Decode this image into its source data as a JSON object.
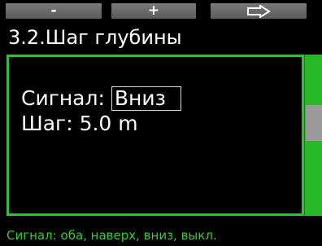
{
  "softkeys": {
    "minus_label": "-",
    "plus_label": "+",
    "next_icon": "arrow-right-outline-icon"
  },
  "title": "3.2.Шаг глубины",
  "settings": {
    "signal_label": "Сигнал:",
    "signal_value": "Вниз",
    "step_label": "Шаг:",
    "step_value": "5.0 m"
  },
  "scrollbar": {
    "position_fraction": 0.4
  },
  "hint": "Сигнал: оба, наверх, вниз, выкл.",
  "colors": {
    "accent": "#2fc12f",
    "background": "#000000",
    "softkey": "#6b6b6b"
  }
}
